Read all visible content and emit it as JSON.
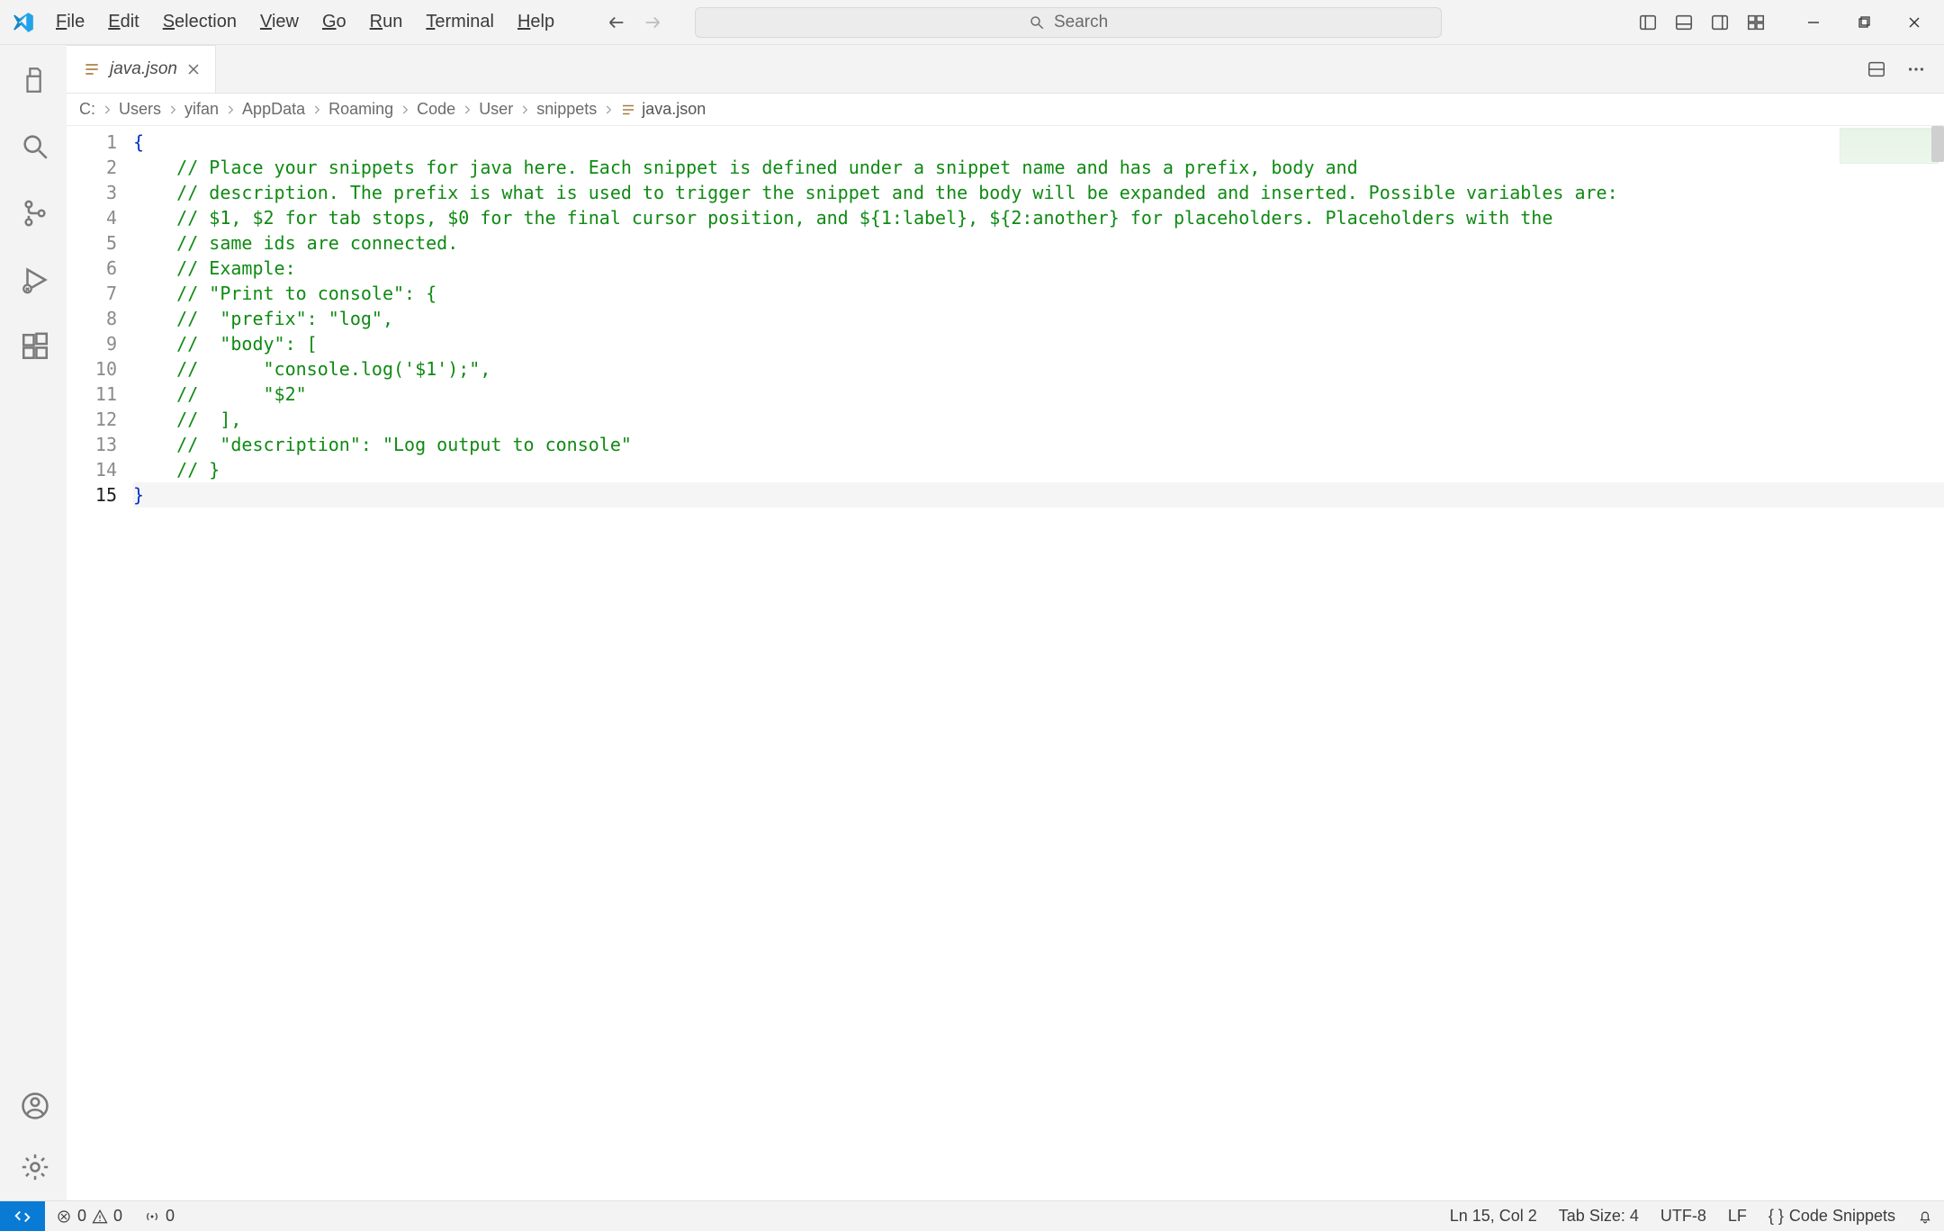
{
  "menu": {
    "file": "File",
    "edit": "Edit",
    "selection": "Selection",
    "view": "View",
    "go": "Go",
    "run": "Run",
    "terminal": "Terminal",
    "help": "Help"
  },
  "search": {
    "placeholder": "Search"
  },
  "tab": {
    "filename": "java.json"
  },
  "breadcrumbs": {
    "segments": [
      "C:",
      "Users",
      "yifan",
      "AppData",
      "Roaming",
      "Code",
      "User",
      "snippets"
    ],
    "file": "java.json"
  },
  "editor": {
    "current_line": 15,
    "lines": [
      {
        "n": 1,
        "indent": "",
        "kind": "brace",
        "text": "{"
      },
      {
        "n": 2,
        "indent": "    ",
        "kind": "comment",
        "text": "// Place your snippets for java here. Each snippet is defined under a snippet name and has a prefix, body and"
      },
      {
        "n": 3,
        "indent": "    ",
        "kind": "comment",
        "text": "// description. The prefix is what is used to trigger the snippet and the body will be expanded and inserted. Possible variables are:"
      },
      {
        "n": 4,
        "indent": "    ",
        "kind": "comment",
        "text": "// $1, $2 for tab stops, $0 for the final cursor position, and ${1:label}, ${2:another} for placeholders. Placeholders with the "
      },
      {
        "n": 5,
        "indent": "    ",
        "kind": "comment",
        "text": "// same ids are connected."
      },
      {
        "n": 6,
        "indent": "    ",
        "kind": "comment",
        "text": "// Example:"
      },
      {
        "n": 7,
        "indent": "    ",
        "kind": "comment",
        "text": "// \"Print to console\": {"
      },
      {
        "n": 8,
        "indent": "    ",
        "kind": "comment",
        "text": "//  \"prefix\": \"log\","
      },
      {
        "n": 9,
        "indent": "    ",
        "kind": "comment",
        "text": "//  \"body\": ["
      },
      {
        "n": 10,
        "indent": "    ",
        "kind": "comment",
        "text": "//      \"console.log('$1');\","
      },
      {
        "n": 11,
        "indent": "    ",
        "kind": "comment",
        "text": "//      \"$2\""
      },
      {
        "n": 12,
        "indent": "    ",
        "kind": "comment",
        "text": "//  ],"
      },
      {
        "n": 13,
        "indent": "    ",
        "kind": "comment",
        "text": "//  \"description\": \"Log output to console\""
      },
      {
        "n": 14,
        "indent": "    ",
        "kind": "comment",
        "text": "// }"
      },
      {
        "n": 15,
        "indent": "",
        "kind": "brace",
        "text": "}"
      }
    ]
  },
  "status": {
    "errors": "0",
    "warnings": "0",
    "ports": "0",
    "cursor": "Ln 15, Col 2",
    "spaces": "Tab Size: 4",
    "encoding": "UTF-8",
    "eol": "LF",
    "language": "Code Snippets"
  }
}
